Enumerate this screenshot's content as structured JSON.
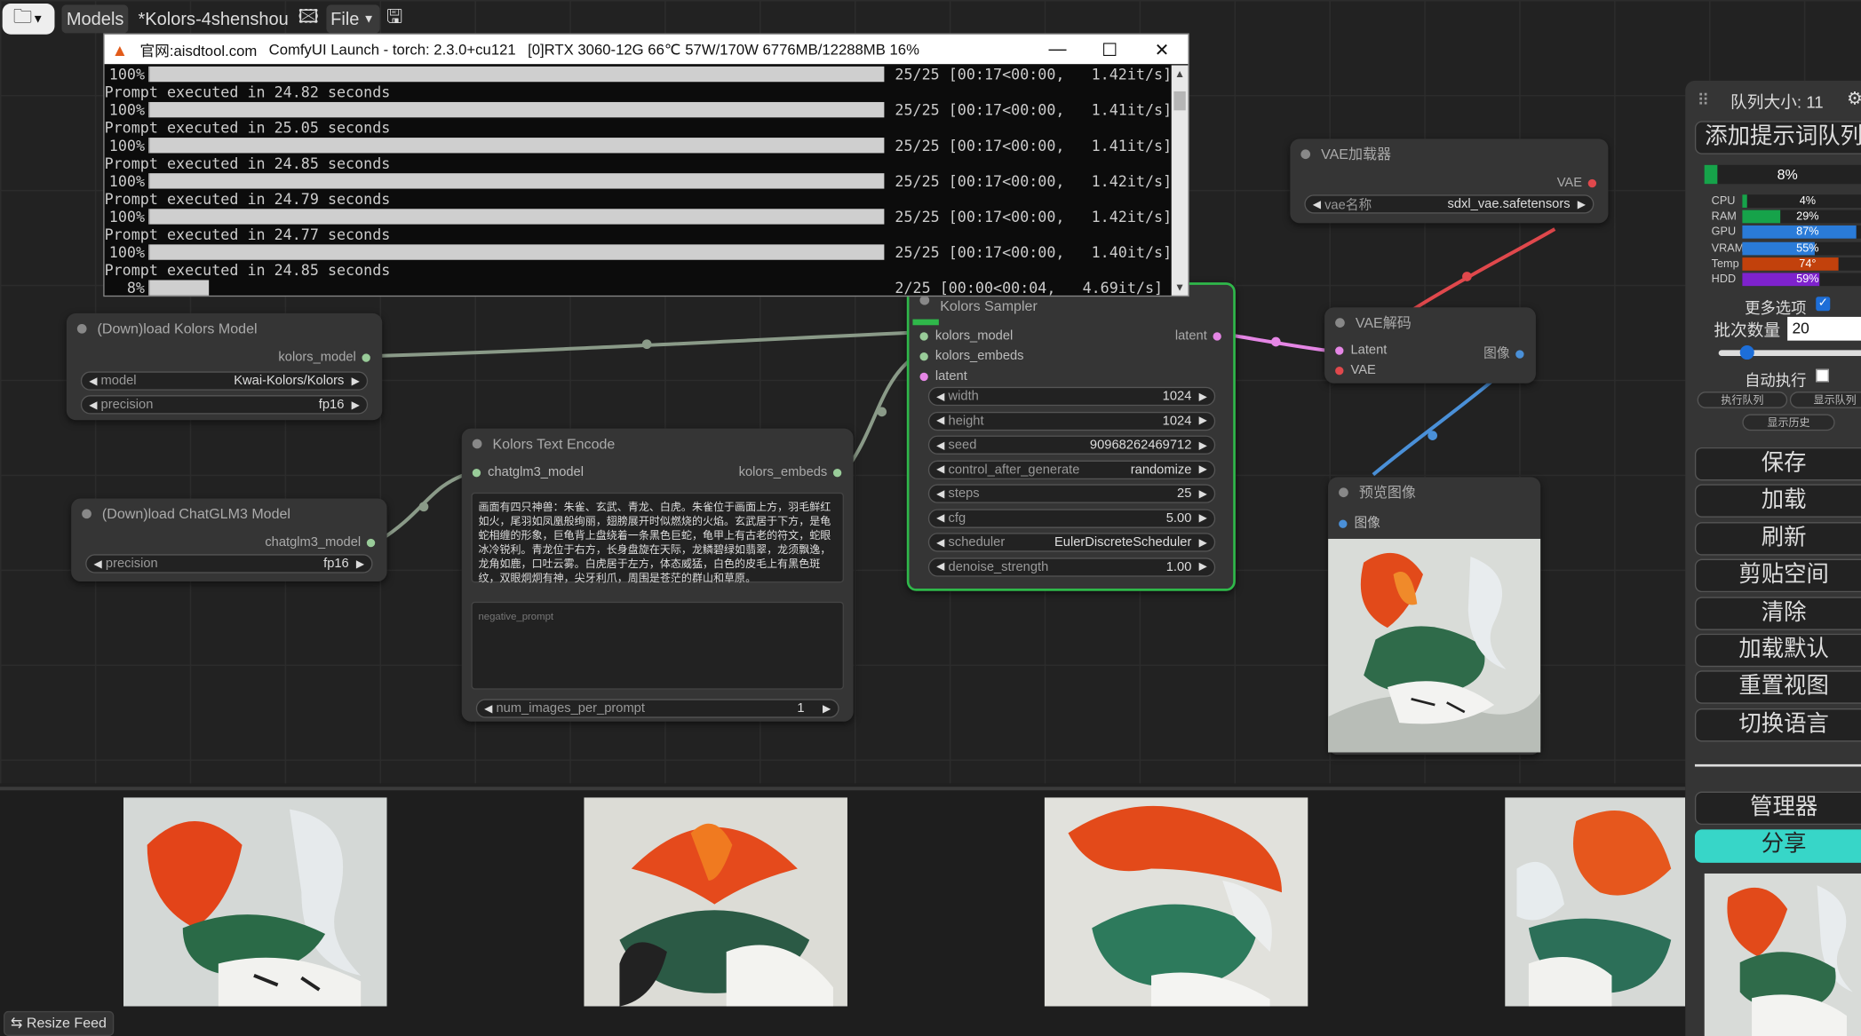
{
  "topbar": {
    "models_label": "Models",
    "workflow_title": "*Kolors-4shenshou",
    "file_label": "File"
  },
  "console": {
    "window_title_site": "官网:aisdtool.com",
    "window_title_app": "ComfyUI Launch - torch: 2.3.0+cu121",
    "window_title_gpu": "[0]RTX 3060-12G 66℃ 57W/170W 6776MB/12288MB 16%",
    "lines": [
      {
        "type": "bar",
        "pct": "100%",
        "fill": 1.0,
        "right": "25/25 [00:17<00:00,   1.42it/s]"
      },
      {
        "type": "text",
        "text": "Prompt executed in 24.82 seconds"
      },
      {
        "type": "bar",
        "pct": "100%",
        "fill": 1.0,
        "right": "25/25 [00:17<00:00,   1.41it/s]"
      },
      {
        "type": "text",
        "text": "Prompt executed in 25.05 seconds"
      },
      {
        "type": "bar",
        "pct": "100%",
        "fill": 1.0,
        "right": "25/25 [00:17<00:00,   1.41it/s]"
      },
      {
        "type": "text",
        "text": "Prompt executed in 24.85 seconds"
      },
      {
        "type": "bar",
        "pct": "100%",
        "fill": 1.0,
        "right": "25/25 [00:17<00:00,   1.42it/s]"
      },
      {
        "type": "text",
        "text": "Prompt executed in 24.79 seconds"
      },
      {
        "type": "bar",
        "pct": "100%",
        "fill": 1.0,
        "right": "25/25 [00:17<00:00,   1.42it/s]"
      },
      {
        "type": "text",
        "text": "Prompt executed in 24.77 seconds"
      },
      {
        "type": "bar",
        "pct": "100%",
        "fill": 1.0,
        "right": "25/25 [00:17<00:00,   1.40it/s]"
      },
      {
        "type": "text",
        "text": "Prompt executed in 24.85 seconds"
      },
      {
        "type": "bar",
        "pct": "8%",
        "fill": 0.08,
        "right": "2/25 [00:00<00:04,   4.69it/s]"
      }
    ]
  },
  "nodes": {
    "load_kolors": {
      "title": "(Down)load Kolors Model",
      "output": "kolors_model",
      "widgets": [
        {
          "label": "model",
          "value": "Kwai-Kolors/Kolors"
        },
        {
          "label": "precision",
          "value": "fp16"
        }
      ]
    },
    "load_chatglm": {
      "title": "(Down)load ChatGLM3 Model",
      "output": "chatglm3_model",
      "widgets": [
        {
          "label": "precision",
          "value": "fp16"
        }
      ]
    },
    "text_encode": {
      "title": "Kolors Text Encode",
      "input": "chatglm3_model",
      "output": "kolors_embeds",
      "prompt": "画面有四只神兽：朱雀、玄武、青龙、白虎。朱雀位于画面上方，羽毛鲜红如火，尾羽如凤凰般绚丽，翅膀展开时似燃烧的火焰。玄武居于下方，是龟蛇相缠的形象，巨龟背上盘绕着一条黑色巨蛇，龟甲上有古老的符文，蛇眼冰冷锐利。青龙位于右方，长身盘旋在天际，龙鳞碧绿如翡翠，龙须飘逸，龙角如鹿，口吐云雾。白虎居于左方，体态威猛，白色的皮毛上有黑色斑纹，双眼炯炯有神，尖牙利爪，周围是苍茫的群山和草原。",
      "negative_placeholder": "negative_prompt",
      "widgets": [
        {
          "label": "num_images_per_prompt",
          "value": "1"
        }
      ]
    },
    "sampler": {
      "title": "Kolors Sampler",
      "inputs": [
        "kolors_model",
        "kolors_embeds",
        "latent"
      ],
      "output": "latent",
      "widgets": [
        {
          "label": "width",
          "value": "1024"
        },
        {
          "label": "height",
          "value": "1024"
        },
        {
          "label": "seed",
          "value": "90968262469712"
        },
        {
          "label": "control_after_generate",
          "value": "randomize"
        },
        {
          "label": "steps",
          "value": "25"
        },
        {
          "label": "cfg",
          "value": "5.00"
        },
        {
          "label": "scheduler",
          "value": "EulerDiscreteScheduler"
        },
        {
          "label": "denoise_strength",
          "value": "1.00"
        }
      ]
    },
    "vae_loader": {
      "title": "VAE加载器",
      "output": "VAE",
      "widgets": [
        {
          "label": "vae名称",
          "value": "sdxl_vae.safetensors"
        }
      ]
    },
    "vae_decode": {
      "title": "VAE解码",
      "inputs": [
        "Latent",
        "VAE"
      ],
      "output": "图像"
    },
    "preview": {
      "title": "预览图像",
      "input": "图像"
    }
  },
  "sidebar": {
    "queue_size": "队列大小: 11",
    "add_prompt_queue": "添加提示词队列",
    "progress_text": "8%",
    "progress": 0.08,
    "monitors": [
      {
        "label": "CPU",
        "value": "4%",
        "fill": 0.04,
        "color": "#16a34a"
      },
      {
        "label": "RAM",
        "value": "29%",
        "fill": 0.29,
        "color": "#16a34a"
      },
      {
        "label": "GPU",
        "value": "87%",
        "fill": 0.87,
        "color": "#2a7bd8"
      },
      {
        "label": "VRAM",
        "value": "55%",
        "fill": 0.55,
        "color": "#2a7bd8"
      },
      {
        "label": "Temp",
        "value": "74°",
        "fill": 0.74,
        "color": "#c2410c"
      },
      {
        "label": "HDD",
        "value": "59%",
        "fill": 0.59,
        "color": "#7e22ce"
      }
    ],
    "more_options": "更多选项",
    "batch_label": "批次数量",
    "batch_value": "20",
    "auto_queue": "自动执行",
    "exec_queue": "执行队列",
    "show_queue": "显示队列",
    "show_history": "显示历史",
    "buttons": [
      "保存",
      "加载",
      "刷新",
      "剪贴空间",
      "清除",
      "加载默认",
      "重置视图",
      "切换语言"
    ],
    "manager": "管理器",
    "share": "分享",
    "accent": "#37d6c8"
  },
  "feed": {
    "resize_label": "Resize Feed"
  }
}
